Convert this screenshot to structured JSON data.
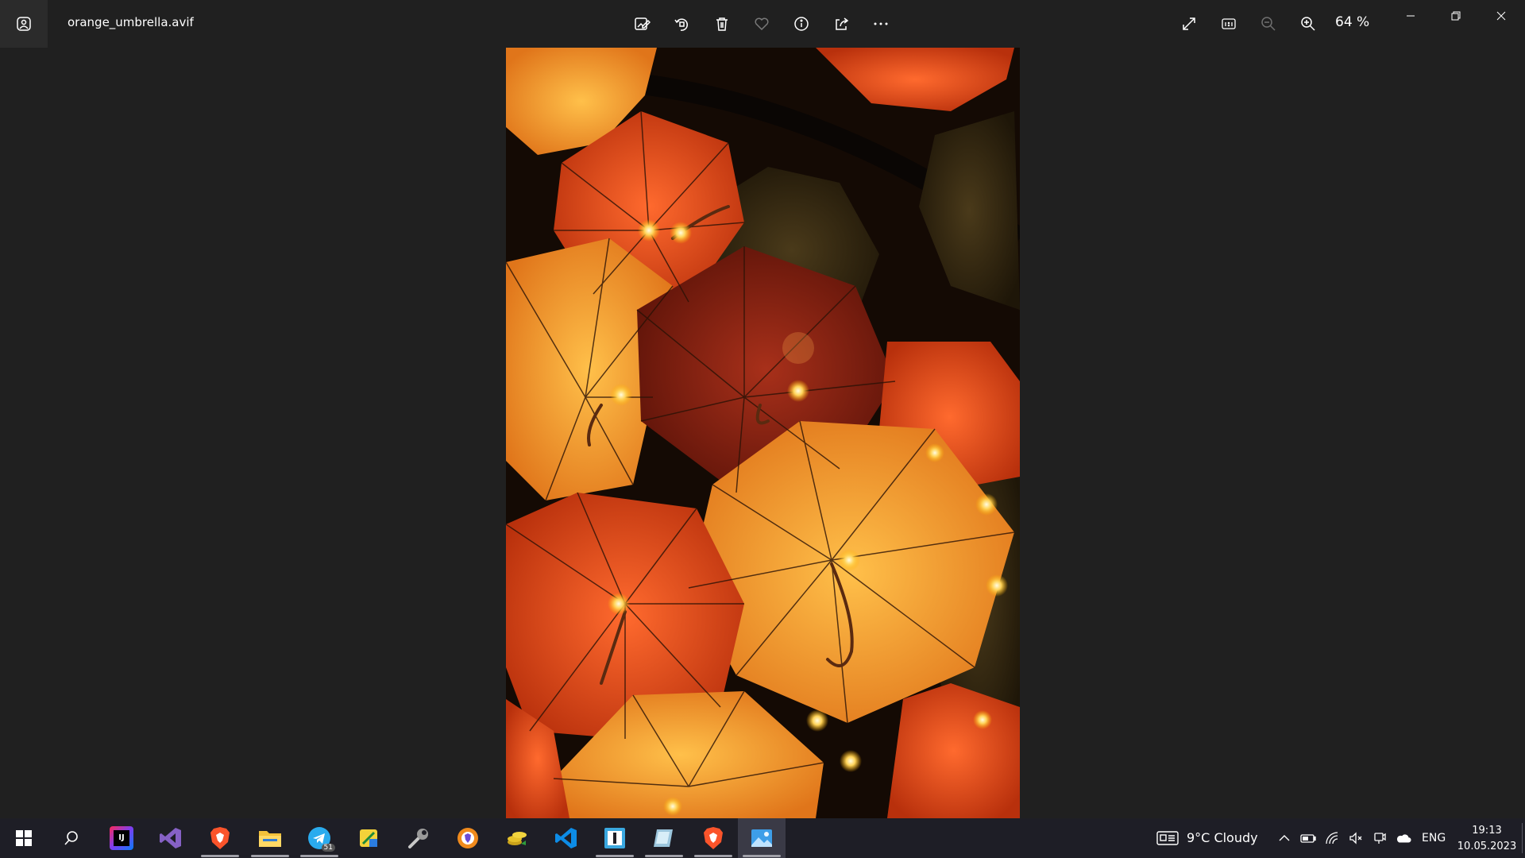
{
  "window": {
    "filename": "orange_umbrella.avif",
    "zoom_level": "64 %"
  },
  "toolbar": {
    "items": [
      "edit-image",
      "rotate",
      "delete",
      "favorite",
      "file-info",
      "share",
      "more"
    ]
  },
  "taskbar": {
    "apps": [
      "start",
      "search",
      "intellij-idea",
      "visual-studio",
      "brave",
      "file-explorer",
      "telegram",
      "sticky-app",
      "tool-app",
      "app-orange",
      "coins-app",
      "vs-code",
      "window-app",
      "disk-app",
      "brave-2",
      "photos"
    ],
    "telegram_badge": "51",
    "weather": "9°C  Cloudy",
    "language": "ENG",
    "time": "19:13",
    "date": "10.05.2023"
  },
  "colors": {
    "background": "#202020",
    "taskbar": "#1e1e26",
    "accent": "#4cc2ff"
  }
}
